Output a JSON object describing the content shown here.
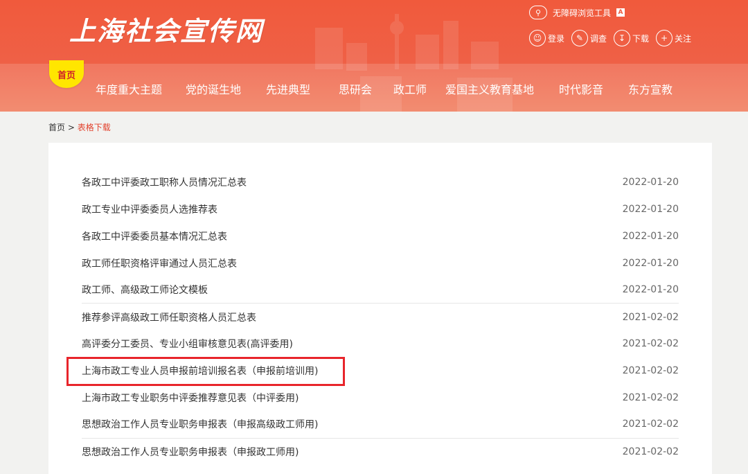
{
  "header": {
    "logo_text": "上海社会宣传网",
    "accessibility_label": "无障碍浏览工具",
    "accessibility_badge": "A",
    "utils": [
      {
        "label": "登录",
        "icon": "user-icon"
      },
      {
        "label": "调查",
        "icon": "survey-icon"
      },
      {
        "label": "下载",
        "icon": "download-icon"
      },
      {
        "label": "关注",
        "icon": "plus-icon"
      }
    ]
  },
  "nav": {
    "home": "首页",
    "items": [
      "年度重大主题",
      "党的诞生地",
      "先进典型",
      "思研会",
      "政工师",
      "爱国主义教育基地",
      "时代影音",
      "东方宣教"
    ]
  },
  "breadcrumb": {
    "home": "首页",
    "separator": ">",
    "current": "表格下载"
  },
  "list": [
    {
      "title": "各政工中评委政工职称人员情况汇总表",
      "date": "2022-01-20"
    },
    {
      "title": "政工专业中评委委员人选推荐表",
      "date": "2022-01-20"
    },
    {
      "title": "各政工中评委委员基本情况汇总表",
      "date": "2022-01-20"
    },
    {
      "title": "政工师任职资格评审通过人员汇总表",
      "date": "2022-01-20"
    },
    {
      "title": "政工师、高级政工师论文模板",
      "date": "2022-01-20"
    },
    {
      "title": "推荐参评高级政工师任职资格人员汇总表",
      "date": "2021-02-02"
    },
    {
      "title": "高评委分工委员、专业小组审核意见表(高评委用)",
      "date": "2021-02-02"
    },
    {
      "title": "上海市政工专业人员申报前培训报名表（申报前培训用)",
      "date": "2021-02-02"
    },
    {
      "title": "上海市政工专业职务中评委推荐意见表（中评委用)",
      "date": "2021-02-02"
    },
    {
      "title": "思想政治工作人员专业职务申报表（申报高级政工师用)",
      "date": "2021-02-02"
    },
    {
      "title": "思想政治工作人员专业职务申报表（申报政工师用)",
      "date": "2021-02-02"
    }
  ],
  "colors": {
    "header_red": "#ef5a3c",
    "home_badge_yellow": "#ffe600",
    "breadcrumb_current": "#e2412c",
    "highlight_border": "#e8252b"
  }
}
